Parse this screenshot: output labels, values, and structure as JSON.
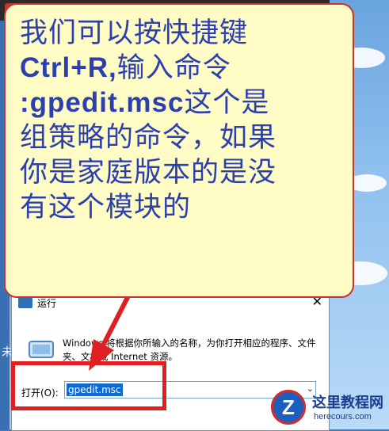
{
  "callout": {
    "line1": "我们可以按快捷键",
    "line2_shortcut": "Ctrl+R,",
    "line2_rest": "输入命令",
    "line3_command": ":gpedit.msc",
    "line3_rest": "这个是",
    "line4": "组策略的命令，如果",
    "line5": "你是家庭版本的是没",
    "line6": "有这个模块的"
  },
  "run_dialog": {
    "title": "运行",
    "description": "Windows 将根据你所输入的名称，为你打开相应的程序、文件夹、文档或 Internet 资源。",
    "open_label": "打开(O):",
    "input_value": "gpedit.msc",
    "close_glyph": "✕",
    "dropdown_glyph": "⌄"
  },
  "desktop": {
    "left_char": "未"
  },
  "watermark": {
    "logo_letter": "Z",
    "title": "这里教程网",
    "url": "herecours.com"
  },
  "colors": {
    "callout_bg": "#fffbc4",
    "callout_border": "#c93232",
    "callout_text": "#2b3fb0",
    "highlight": "#e02020",
    "selection": "#0b6bd3"
  }
}
